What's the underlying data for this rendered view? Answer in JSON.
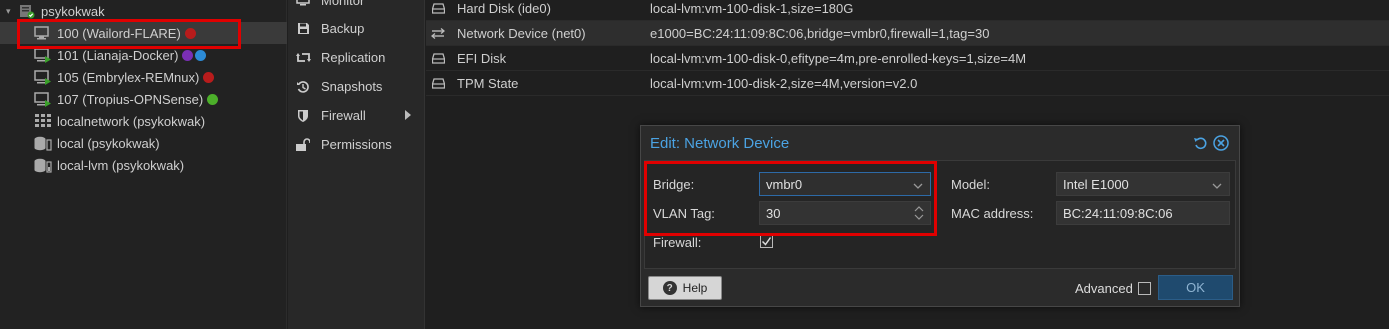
{
  "tree": {
    "node": "psykokwak",
    "items": [
      {
        "label": "100 (Wailord-FLARE)",
        "status_color": "#b81c1c",
        "status_color2": null
      },
      {
        "label": "101 (Lianaja-Docker)",
        "status_color": "#7a2fb5",
        "status_color2": "#2c8bd6"
      },
      {
        "label": "105 (Embrylex-REMnux)",
        "status_color": "#b81c1c",
        "status_color2": null
      },
      {
        "label": "107 (Tropius-OPNSense)",
        "status_color": "#4caf2a",
        "status_color2": null
      },
      {
        "label": "localnetwork (psykokwak)"
      },
      {
        "label": "local (psykokwak)"
      },
      {
        "label": "local-lvm (psykokwak)"
      }
    ]
  },
  "nav": {
    "items": [
      {
        "label": "Monitor",
        "icon": "monitor-icon"
      },
      {
        "label": "Backup",
        "icon": "floppy-icon"
      },
      {
        "label": "Replication",
        "icon": "retweet-icon"
      },
      {
        "label": "Snapshots",
        "icon": "history-icon"
      },
      {
        "label": "Firewall",
        "icon": "shield-icon"
      },
      {
        "label": "Permissions",
        "icon": "unlock-icon"
      }
    ]
  },
  "hardware": {
    "rows": [
      {
        "name": "Hard Disk (ide0)",
        "value": "local-lvm:vm-100-disk-1,size=180G",
        "icon": "hdd-icon"
      },
      {
        "name": "Network Device (net0)",
        "value": "e1000=BC:24:11:09:8C:06,bridge=vmbr0,firewall=1,tag=30",
        "icon": "exchange-icon"
      },
      {
        "name": "EFI Disk",
        "value": "local-lvm:vm-100-disk-0,efitype=4m,pre-enrolled-keys=1,size=4M",
        "icon": "hdd-icon"
      },
      {
        "name": "TPM State",
        "value": "local-lvm:vm-100-disk-2,size=4M,version=v2.0",
        "icon": "hdd-icon"
      }
    ]
  },
  "dialog": {
    "title": "Edit: Network Device",
    "bridge_label": "Bridge:",
    "bridge_value": "vmbr0",
    "vlan_label": "VLAN Tag:",
    "vlan_value": "30",
    "firewall_label": "Firewall:",
    "firewall_checked": true,
    "model_label": "Model:",
    "model_value": "Intel E1000",
    "mac_label": "MAC address:",
    "mac_value": "BC:24:11:09:8C:06",
    "help_label": "Help",
    "advanced_label": "Advanced",
    "ok_label": "OK"
  },
  "colors": {
    "accent": "#4ba3e3",
    "highlight": "#e00000"
  }
}
